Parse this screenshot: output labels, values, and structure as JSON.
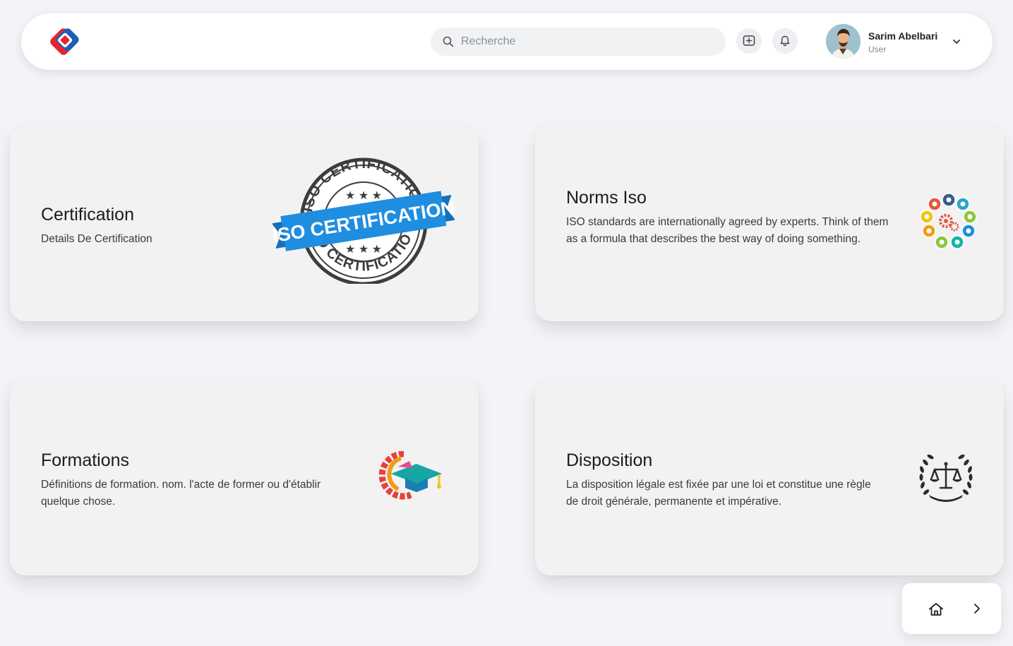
{
  "header": {
    "search": {
      "placeholder": "Recherche",
      "value": ""
    },
    "add_icon": "add-square-icon",
    "bell_icon": "bell-icon",
    "user": {
      "name": "Sarim Abelbari",
      "role": "User"
    }
  },
  "cards": [
    {
      "title": "Certification",
      "description": "Details De Certification",
      "image": "iso-certification-stamp-icon",
      "stamp": {
        "ribbon": "ISO CERTIFICATION",
        "ring": "ISO CERTIFICATION"
      }
    },
    {
      "title": "Norms Iso",
      "description": "ISO standards are internationally agreed by experts. Think of them as a formula that describes the best way of doing something.",
      "image": "gears-cycle-icon"
    },
    {
      "title": "Formations",
      "description": "Définitions de formation. nom. l'acte de former ou d'établir quelque chose.",
      "image": "graduation-gear-icon"
    },
    {
      "title": "Disposition",
      "description": "La disposition légale est fixée par une loi et constitue une règle de droit générale, permanente et impérative.",
      "image": "justice-scales-laurel-icon"
    }
  ],
  "nav": {
    "home_icon": "home-icon",
    "next_icon": "chevron-right-icon"
  },
  "colors": {
    "background": "#f3f4f7",
    "card": "#f2f2f2",
    "ribbon_blue": "#1f8ee0",
    "logo_red": "#e8232f",
    "logo_blue": "#1e5fb4"
  }
}
